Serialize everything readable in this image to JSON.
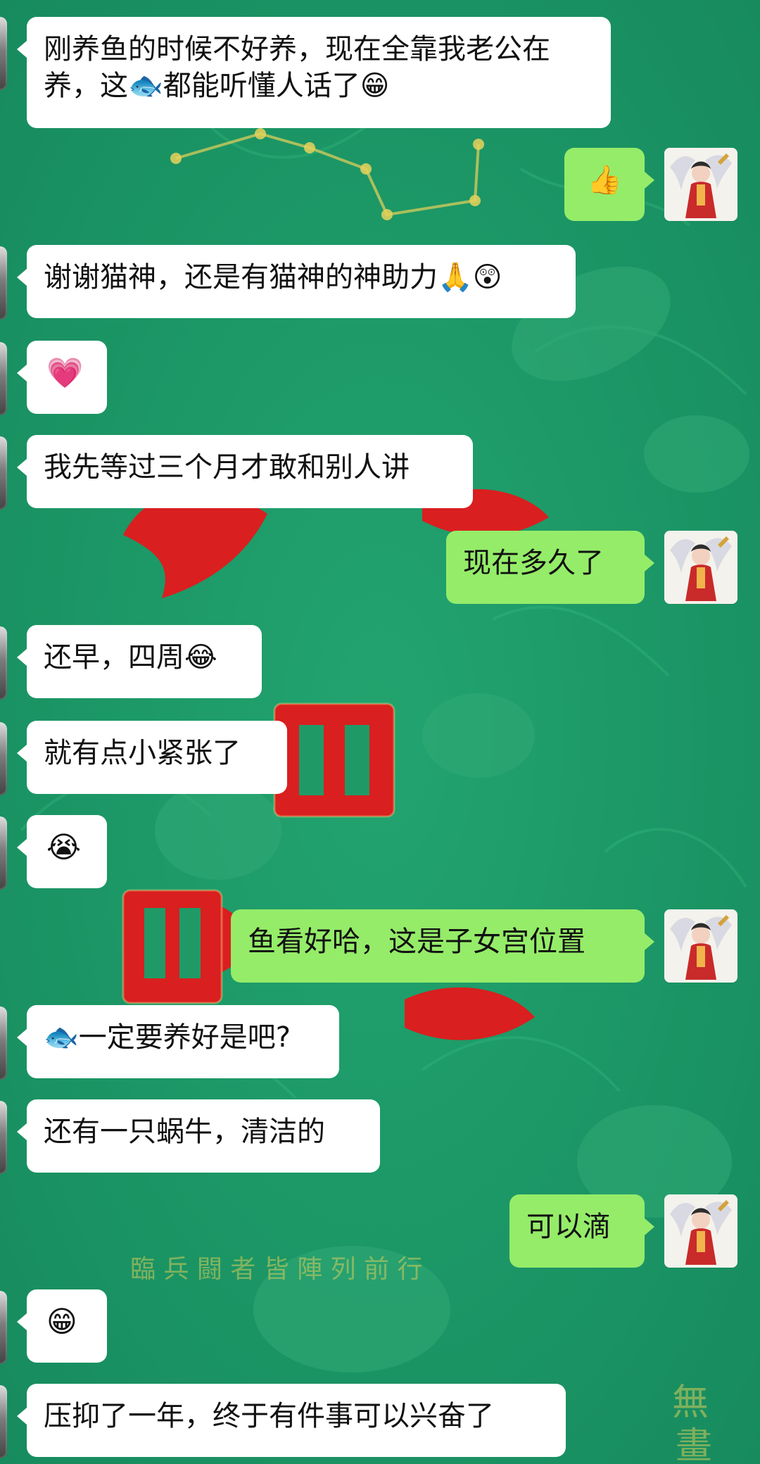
{
  "background": {
    "colors": {
      "green": "#1f9a66",
      "dark_green": "#168a5d",
      "red": "#d91f1f",
      "gold": "#e5d15a"
    },
    "watermark_text": "臨兵闘者皆陣列前行",
    "right_edge_text": "無畫"
  },
  "messages": [
    {
      "side": "left",
      "text": "刚养鱼的时候不好养，现在全靠我老公在养，这🐟都能听懂人话了😁"
    },
    {
      "side": "right",
      "text": "👍"
    },
    {
      "side": "left",
      "text": "谢谢猫神，还是有猫神的神助力🙏😲"
    },
    {
      "side": "left",
      "text": "💗"
    },
    {
      "side": "left",
      "text": "我先等过三个月才敢和别人讲"
    },
    {
      "side": "right",
      "text": "现在多久了"
    },
    {
      "side": "left",
      "text": "还早，四周😂"
    },
    {
      "side": "left",
      "text": "就有点小紧张了"
    },
    {
      "side": "left",
      "text": "😭"
    },
    {
      "side": "right",
      "text": "鱼看好哈，这是子女宫位置"
    },
    {
      "side": "left",
      "text": "🐟一定要养好是吧?"
    },
    {
      "side": "left",
      "text": "还有一只蜗牛，清洁的"
    },
    {
      "side": "right",
      "text": "可以滴"
    },
    {
      "side": "left",
      "text": "😁"
    },
    {
      "side": "left",
      "text": "压抑了一年，终于有件事可以兴奋了"
    }
  ]
}
